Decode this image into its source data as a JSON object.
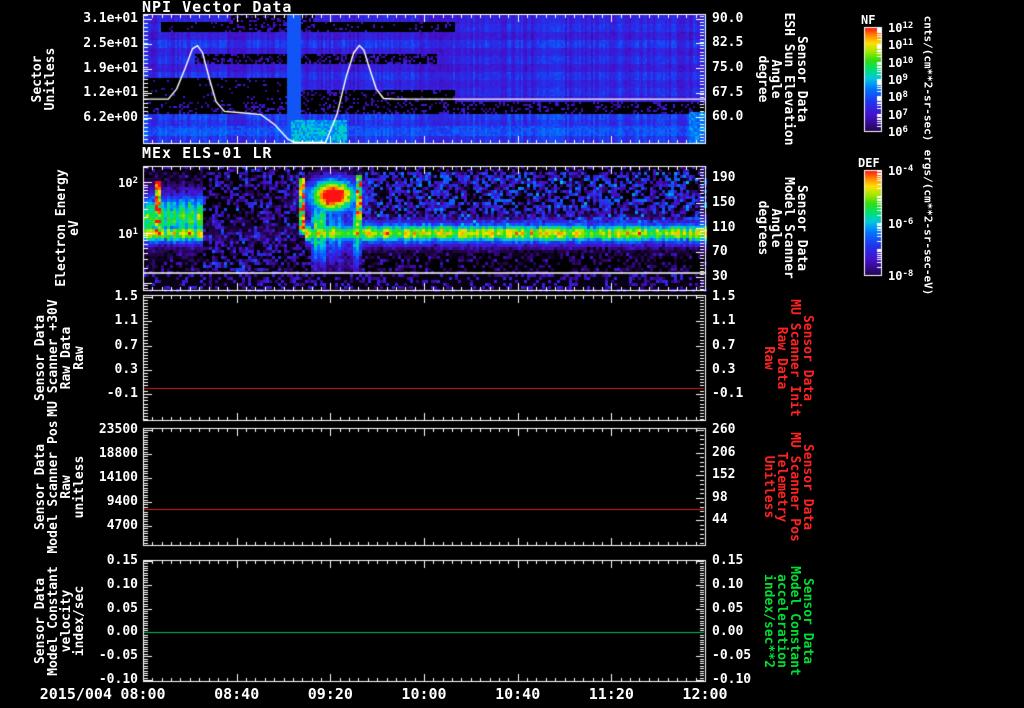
{
  "colors": {
    "background": "#000000",
    "foreground": "#ffffff",
    "red_label": "#ff2222",
    "green_label": "#00dd33",
    "red_line": "#d42222",
    "green_line": "#00c050"
  },
  "x_axis": {
    "date_label": "2015/004",
    "tick_labels": [
      "08:00",
      "08:40",
      "09:20",
      "10:00",
      "10:40",
      "11:20",
      "12:00"
    ],
    "minor_per_major": 10
  },
  "chart_data": [
    {
      "type": "spectrogram",
      "title": "NPI Vector Data",
      "left_axis": {
        "label_lines": [
          "Sector",
          "Unitless"
        ],
        "ylim": [
          0.0,
          32.3
        ],
        "minor_step": 1.0,
        "ticks": [
          {
            "v": 31,
            "l": "3.1e+01"
          },
          {
            "v": 24.8,
            "l": "2.5e+01"
          },
          {
            "v": 18.6,
            "l": "1.9e+01"
          },
          {
            "v": 12.4,
            "l": "1.2e+01"
          },
          {
            "v": 6.2,
            "l": "6.2e+00"
          }
        ]
      },
      "right_axis": {
        "label_lines": [
          "Sensor Data",
          "ESH Sun Elevation",
          "Angle",
          "degree"
        ],
        "label_color": "#ffffff",
        "ylim": [
          52.1,
          91.5
        ],
        "minor_step": 1.0,
        "ticks": [
          {
            "v": 90,
            "l": "90.0"
          },
          {
            "v": 82.5,
            "l": "82.5"
          },
          {
            "v": 75,
            "l": "75.0"
          },
          {
            "v": 67.5,
            "l": "67.5"
          },
          {
            "v": 60,
            "l": "60.0"
          }
        ]
      },
      "colorbar": {
        "label": "NF",
        "units": "cnts/(cm**2-sr-sec)",
        "tick_exponents": [
          12,
          11,
          10,
          9,
          8,
          7,
          6
        ]
      },
      "overlay_line": {
        "color": "#ffffff",
        "points": [
          [
            0,
            0.66
          ],
          [
            0.045,
            0.66
          ],
          [
            0.06,
            0.58
          ],
          [
            0.075,
            0.42
          ],
          [
            0.088,
            0.27
          ],
          [
            0.097,
            0.245
          ],
          [
            0.106,
            0.3
          ],
          [
            0.118,
            0.5
          ],
          [
            0.13,
            0.68
          ],
          [
            0.145,
            0.755
          ],
          [
            0.175,
            0.765
          ],
          [
            0.21,
            0.78
          ],
          [
            0.235,
            0.86
          ],
          [
            0.258,
            0.97
          ],
          [
            0.27,
            1.0
          ],
          [
            0.325,
            1.0
          ],
          [
            0.345,
            0.78
          ],
          [
            0.362,
            0.48
          ],
          [
            0.375,
            0.3
          ],
          [
            0.385,
            0.245
          ],
          [
            0.393,
            0.28
          ],
          [
            0.403,
            0.42
          ],
          [
            0.415,
            0.58
          ],
          [
            0.428,
            0.655
          ],
          [
            0.45,
            0.66
          ],
          [
            1.0,
            0.66
          ]
        ]
      },
      "spectro": {
        "rows": [
          0.27,
          0.3,
          0.25,
          0.32,
          0.26,
          0.3,
          0.25,
          0.31,
          0.27,
          0.3,
          0.26,
          0.29,
          0.34,
          0.31,
          0.36,
          0.32
        ],
        "features": [
          {
            "x": [
              0.03,
              0.555
            ],
            "y": [
              0.055,
              0.125
            ],
            "v": 0,
            "mode": "set",
            "speckle": 0.1
          },
          {
            "x": [
              0.155,
              0.305
            ],
            "y": [
              0.0,
              0.125
            ],
            "v": 0,
            "mode": "set",
            "speckle": 0.3
          },
          {
            "x": [
              0.09,
              0.52
            ],
            "y": [
              0.295,
              0.375
            ],
            "v": 0,
            "mode": "set",
            "speckle": 0.35
          },
          {
            "x": [
              0.0,
              0.26
            ],
            "y": [
              0.49,
              0.77
            ],
            "v": 0,
            "mode": "set",
            "speckle": 0.06
          },
          {
            "x": [
              0.26,
              0.555
            ],
            "y": [
              0.585,
              0.77
            ],
            "v": 0,
            "mode": "set",
            "speckle": 0.18
          },
          {
            "x": [
              0.0,
              1.0
            ],
            "y": [
              0.667,
              0.767
            ],
            "v": 0,
            "mode": "set",
            "speckle": 0.22
          },
          {
            "x": [
              0.255,
              0.278
            ],
            "y": [
              0.0,
              1.0
            ],
            "v": 0.4,
            "mode": "set",
            "speckle": 0
          },
          {
            "x": [
              0.262,
              0.36
            ],
            "y": [
              0.82,
              1.0
            ],
            "v": 0.52,
            "mode": "max",
            "speckle": 0
          },
          {
            "x": [
              0.97,
              1.0
            ],
            "y": [
              0.75,
              1.0
            ],
            "v": 0.46,
            "mode": "max",
            "speckle": 0
          },
          {
            "x": [
              0.0,
              1.0
            ],
            "y": [
              0.86,
              0.935
            ],
            "v": 0.37,
            "mode": "max",
            "speckle": 0
          }
        ]
      }
    },
    {
      "type": "spectrogram",
      "title": "MEx ELS-01 LR",
      "left_axis": {
        "label_lines": [
          "Electron Energy",
          "eV"
        ],
        "log": true,
        "ylim": [
          0.72,
          210
        ],
        "ticks": [
          {
            "exp": 2
          },
          {
            "exp": 1
          }
        ]
      },
      "right_axis": {
        "label_lines": [
          "Sensor Data",
          "Model Scanner",
          "Angle",
          "degrees"
        ],
        "label_color": "#ffffff",
        "ylim": [
          9.0,
          209.4
        ],
        "minor_step": 5,
        "ticks": [
          {
            "v": 190,
            "l": "190"
          },
          {
            "v": 150,
            "l": "150"
          },
          {
            "v": 110,
            "l": "110"
          },
          {
            "v": 70,
            "l": "70"
          },
          {
            "v": 30,
            "l": "30"
          }
        ]
      },
      "colorbar": {
        "label": "DEF",
        "units": "ergs/(cm**2-sr-sec-eV)",
        "tick_exponents": [
          -4,
          -6,
          -8
        ]
      },
      "overlay_line": {
        "color": "#ffffff",
        "points": [
          [
            0,
            0.863
          ],
          [
            1,
            0.863
          ]
        ]
      },
      "spectro": {
        "band": {
          "center": 0.53,
          "sigma": 0.1,
          "amp": 0.62,
          "core_amp": 0.18,
          "core_sigma": 0.045
        },
        "gap_x": [
          0.105,
          0.285
        ],
        "left_blob": {
          "x_max": 0.105,
          "center": 0.4,
          "sigma": 0.2,
          "amp": 0.65
        },
        "red_streak_left": {
          "x": [
            0.02,
            0.03
          ],
          "y": [
            0.1,
            0.55
          ],
          "amp": 0.95
        },
        "red_blob": {
          "cx": 0.335,
          "sx": 0.045,
          "cy": 0.23,
          "sy": 0.14,
          "amp": 1.15
        },
        "edge_streaks": [
          {
            "x": [
              0.277,
              0.283
            ],
            "y": [
              0.08,
              0.55
            ],
            "amp": 0.9
          },
          {
            "x": [
              0.378,
              0.385
            ],
            "y": [
              0.05,
              0.5
            ],
            "amp": 0.85
          }
        ],
        "blob_columns": {
          "x": [
            0.295,
            0.385
          ]
        },
        "bottom_dark_y": 0.865
      }
    },
    {
      "type": "line",
      "title": "",
      "left_axis": {
        "label_lines": [
          "Sensor Data",
          "MU Scanner +30V",
          "Raw Data",
          "Raw"
        ],
        "ylim": [
          -0.52,
          1.53
        ],
        "minor_step": 0.05,
        "ticks": [
          {
            "v": 1.5,
            "l": "1.5"
          },
          {
            "v": 1.1,
            "l": "1.1"
          },
          {
            "v": 0.7,
            "l": "0.7"
          },
          {
            "v": 0.3,
            "l": "0.3"
          },
          {
            "v": -0.1,
            "l": "-0.1"
          }
        ]
      },
      "right_axis": {
        "label_lines": [
          "Sensor Data",
          "MU Scanner Init",
          "Raw Data",
          "Raw"
        ],
        "label_color": "#ff2222",
        "ylim": [
          -0.52,
          1.53
        ],
        "minor_step": 0.05,
        "ticks": [
          {
            "v": 1.5,
            "l": "1.5"
          },
          {
            "v": 1.1,
            "l": "1.1"
          },
          {
            "v": 0.7,
            "l": "0.7"
          },
          {
            "v": 0.3,
            "l": "0.3"
          },
          {
            "v": -0.1,
            "l": "-0.1"
          }
        ]
      },
      "line": {
        "color": "#d42222",
        "value": 0.0
      }
    },
    {
      "type": "line",
      "title": "",
      "left_axis": {
        "label_lines": [
          "Sensor Data",
          "Model Scanner Pos",
          "Raw",
          "unitless"
        ],
        "ylim": [
          980,
          23890
        ],
        "minor_step": 470,
        "ticks": [
          {
            "v": 23500,
            "l": "23500"
          },
          {
            "v": 18800,
            "l": "18800"
          },
          {
            "v": 14100,
            "l": "14100"
          },
          {
            "v": 9400,
            "l": "9400"
          },
          {
            "v": 4700,
            "l": "4700"
          }
        ]
      },
      "right_axis": {
        "label_lines": [
          "Sensor Data",
          "MU Scanner Pos",
          "Telemetry",
          "Unitless"
        ],
        "label_color": "#ff2222",
        "ylim": [
          -15.7,
          264.8
        ],
        "minor_step": 10.8,
        "ticks": [
          {
            "v": 260,
            "l": "260"
          },
          {
            "v": 206,
            "l": "206"
          },
          {
            "v": 152,
            "l": "152"
          },
          {
            "v": 98,
            "l": "98"
          },
          {
            "v": 44,
            "l": "44"
          }
        ]
      },
      "line": {
        "color": "#d42222",
        "value": 8000
      }
    },
    {
      "type": "line",
      "title": "",
      "left_axis": {
        "label_lines": [
          "Sensor Data",
          "Model Constant",
          "velocity",
          "index/sec"
        ],
        "ylim": [
          -0.102,
          0.152
        ],
        "minor_step": 0.005,
        "ticks": [
          {
            "v": 0.15,
            "l": "0.15"
          },
          {
            "v": 0.1,
            "l": "0.10"
          },
          {
            "v": 0.05,
            "l": "0.05"
          },
          {
            "v": 0.0,
            "l": "0.00"
          },
          {
            "v": -0.05,
            "l": "-0.05"
          },
          {
            "v": -0.1,
            "l": "-0.10"
          }
        ]
      },
      "right_axis": {
        "label_lines": [
          "Sensor Data",
          "Model Constant",
          "acceleration",
          "index/sec**2"
        ],
        "label_color": "#00dd33",
        "ylim": [
          -0.102,
          0.152
        ],
        "minor_step": 0.005,
        "ticks": [
          {
            "v": 0.15,
            "l": "0.15"
          },
          {
            "v": 0.1,
            "l": "0.10"
          },
          {
            "v": 0.05,
            "l": "0.05"
          },
          {
            "v": 0.0,
            "l": "0.00"
          },
          {
            "v": -0.05,
            "l": "-0.05"
          },
          {
            "v": -0.1,
            "l": "-0.10"
          }
        ]
      },
      "line": {
        "color": "#00c050",
        "value": 0.0
      }
    }
  ]
}
